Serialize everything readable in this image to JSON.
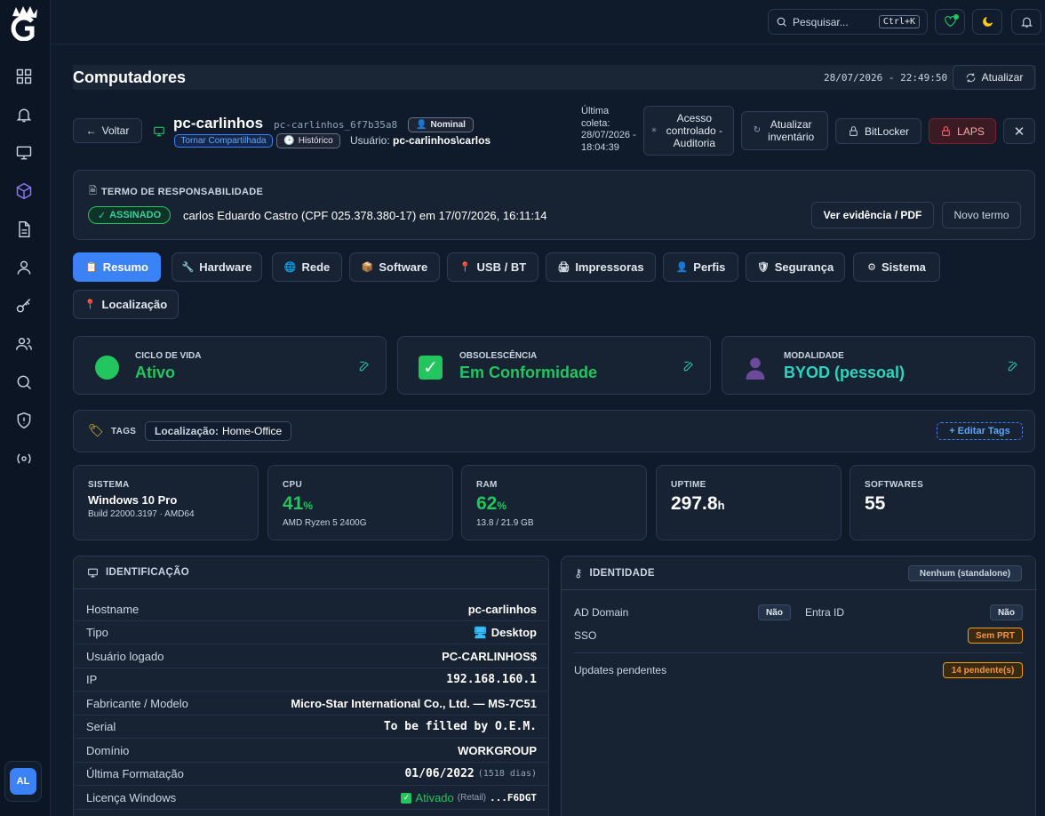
{
  "topbar": {
    "search_placeholder": "Pesquisar...",
    "search_shortcut": "Ctrl+K"
  },
  "sidebar": {
    "avatar_initials": "AL",
    "items": [
      "grid-icon",
      "bell-icon",
      "monitor-icon",
      "cube-icon",
      "document-icon",
      "user-icon",
      "key-icon",
      "users-icon",
      "search-icon",
      "shield-icon",
      "broadcast-icon"
    ]
  },
  "header": {
    "title": "Computadores",
    "datetime": "28/07/2026 - 22:49:50",
    "refresh_label": "Atualizar"
  },
  "device": {
    "back_label": "Voltar",
    "hostname": "pc-carlinhos",
    "host_id": "pc-carlinhos_6f7b35a8",
    "nominal_badge": "Nominal",
    "shared_badge": "Tornar Compartilhada",
    "history_badge": "Histórico",
    "user_prefix": "Usuário:",
    "user": "pc-carlinhos\\carlos",
    "last_collect_label": "Última coleta:",
    "last_collect_value": "28/07/2026 - 18:04:39",
    "actions": {
      "remote_access": "Acesso controlado - Auditoria",
      "update_inventory": "Atualizar inventário",
      "bitlocker": "BitLocker",
      "laps": "LAPS"
    }
  },
  "term": {
    "title": "TERMO DE RESPONSABILIDADE",
    "status": "ASSINADO",
    "text": "carlos Eduardo Castro (CPF 025.378.380-17) em 17/07/2026, 16:11:14",
    "evidence_button": "Ver evidência / PDF",
    "new_term_button": "Novo termo"
  },
  "tabs": [
    {
      "label": "Resumo",
      "icon": "📋"
    },
    {
      "label": "Hardware",
      "icon": "🔧"
    },
    {
      "label": "Rede",
      "icon": "🌐"
    },
    {
      "label": "Software",
      "icon": "📦"
    },
    {
      "label": "USB / BT",
      "icon": "📍"
    },
    {
      "label": "Impressoras",
      "icon": "🖨"
    },
    {
      "label": "Perfis",
      "icon": "👤"
    },
    {
      "label": "Segurança",
      "icon": "🛡"
    },
    {
      "label": "Sistema",
      "icon": "⚙"
    },
    {
      "label": "Localização",
      "icon": "📍"
    }
  ],
  "status_cards": {
    "lifecycle": {
      "label": "CICLO DE VIDA",
      "value": "Ativo",
      "color": "#22c55e"
    },
    "obsolescence": {
      "label": "OBSOLESCÊNCIA",
      "value": "Em Conformidade",
      "color": "#22c55e"
    },
    "modality": {
      "label": "MODALIDADE",
      "value": "BYOD (pessoal)",
      "color": "#2dd4bf"
    }
  },
  "tags": {
    "label": "TAGS",
    "tag_key": "Localização:",
    "tag_value": "Home-Office",
    "edit_button": "+ Editar Tags"
  },
  "metrics": {
    "system": {
      "label": "SISTEMA",
      "value": "Windows 10 Pro",
      "sub": "Build 22000.3197 · AMD64"
    },
    "cpu": {
      "label": "CPU",
      "value": "41",
      "unit": "%",
      "sub": "AMD Ryzen 5 2400G"
    },
    "ram": {
      "label": "RAM",
      "value": "62",
      "unit": "%",
      "sub": "13.8 / 21.9 GB"
    },
    "uptime": {
      "label": "UPTIME",
      "value": "297.8",
      "unit": "h"
    },
    "softwares": {
      "label": "SOFTWARES",
      "value": "55"
    }
  },
  "identification": {
    "title": "IDENTIFICAÇÃO",
    "rows": [
      {
        "key": "Hostname",
        "value": "pc-carlinhos"
      },
      {
        "key": "Tipo",
        "value": "Desktop"
      },
      {
        "key": "Usuário logado",
        "value": "PC-CARLINHOS$"
      },
      {
        "key": "IP",
        "value": "192.168.160.1"
      },
      {
        "key": "Fabricante / Modelo",
        "value": "Micro-Star International Co., Ltd. — MS-7C51"
      },
      {
        "key": "Serial",
        "value": "To be filled by O.E.M."
      },
      {
        "key": "Domínio",
        "value": "WORKGROUP"
      },
      {
        "key": "Última Formatação",
        "value": "01/06/2022",
        "extra": "(1518 dias)"
      },
      {
        "key": "Licença Windows",
        "value": "Ativado",
        "extra": "(Retail)",
        "tail": "...F6DGT"
      }
    ]
  },
  "identity": {
    "title": "IDENTIDADE",
    "badge": "Nenhum (standalone)",
    "ad_domain_label": "AD Domain",
    "ad_domain_value": "Não",
    "entra_id_label": "Entra ID",
    "entra_id_value": "Não",
    "sso_label": "SSO",
    "sso_value": "Sem PRT",
    "updates_label": "Updates pendentes",
    "updates_value": "14 pendente(s)"
  }
}
